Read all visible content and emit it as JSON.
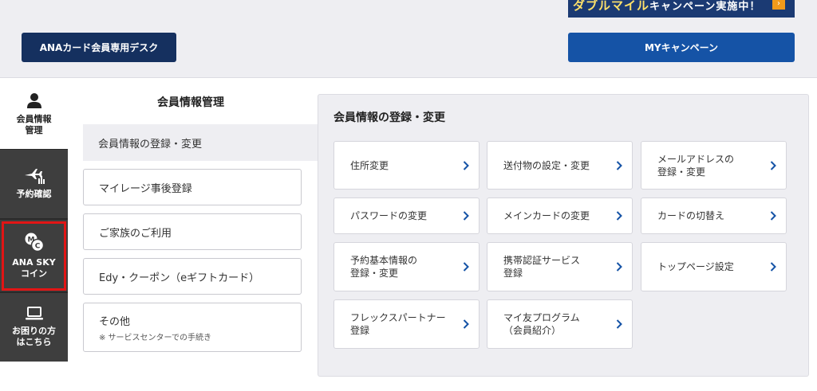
{
  "header": {
    "banner_text_1": "ダブルマイル",
    "banner_text_2": "キャンペーン実施中！",
    "card_desk_label": "ANAカード会員専用デスク",
    "campaign_label": "MYキャンペーン"
  },
  "sidebar": {
    "items": [
      {
        "label_1": "会員情報",
        "label_2": "管理",
        "icon": "person-icon"
      },
      {
        "label_1": "予約確認",
        "icon": "airplane-icon"
      },
      {
        "label_1": "ANA SKY",
        "label_2": "コイン",
        "icon": "coin-icon"
      },
      {
        "label_1": "お困りの方",
        "label_2": "はこちら",
        "icon": "laptop-icon"
      }
    ]
  },
  "submenu": {
    "title": "会員情報管理",
    "items": [
      {
        "label": "会員情報の登録・変更"
      },
      {
        "label": "マイレージ事後登録"
      },
      {
        "label": "ご家族のご利用"
      },
      {
        "label": "Edy・クーポン（eギフトカード）"
      },
      {
        "label": "その他",
        "note": "※ サービスセンターでの手続き"
      }
    ]
  },
  "panel": {
    "title": "会員情報の登録・変更",
    "tiles": [
      {
        "line1": "住所変更"
      },
      {
        "line1": "送付物の設定・変更"
      },
      {
        "line1": "メールアドレスの",
        "line2": "登録・変更"
      },
      {
        "line1": "パスワードの変更"
      },
      {
        "line1": "メインカードの変更"
      },
      {
        "line1": "カードの切替え"
      },
      {
        "line1": "予約基本情報の",
        "line2": "登録・変更"
      },
      {
        "line1": "携帯認証サービス",
        "line2": "登録"
      },
      {
        "line1": "トップページ設定"
      },
      {
        "line1": "フレックスパートナー",
        "line2": "登録"
      },
      {
        "line1": "マイ友プログラム",
        "line2": "（会員紹介）"
      }
    ]
  },
  "colors": {
    "navy": "#15305f",
    "blue": "#1553a6",
    "dark_tab": "#3e3e3e",
    "highlight": "#e11515",
    "chevron": "#1553a6"
  }
}
